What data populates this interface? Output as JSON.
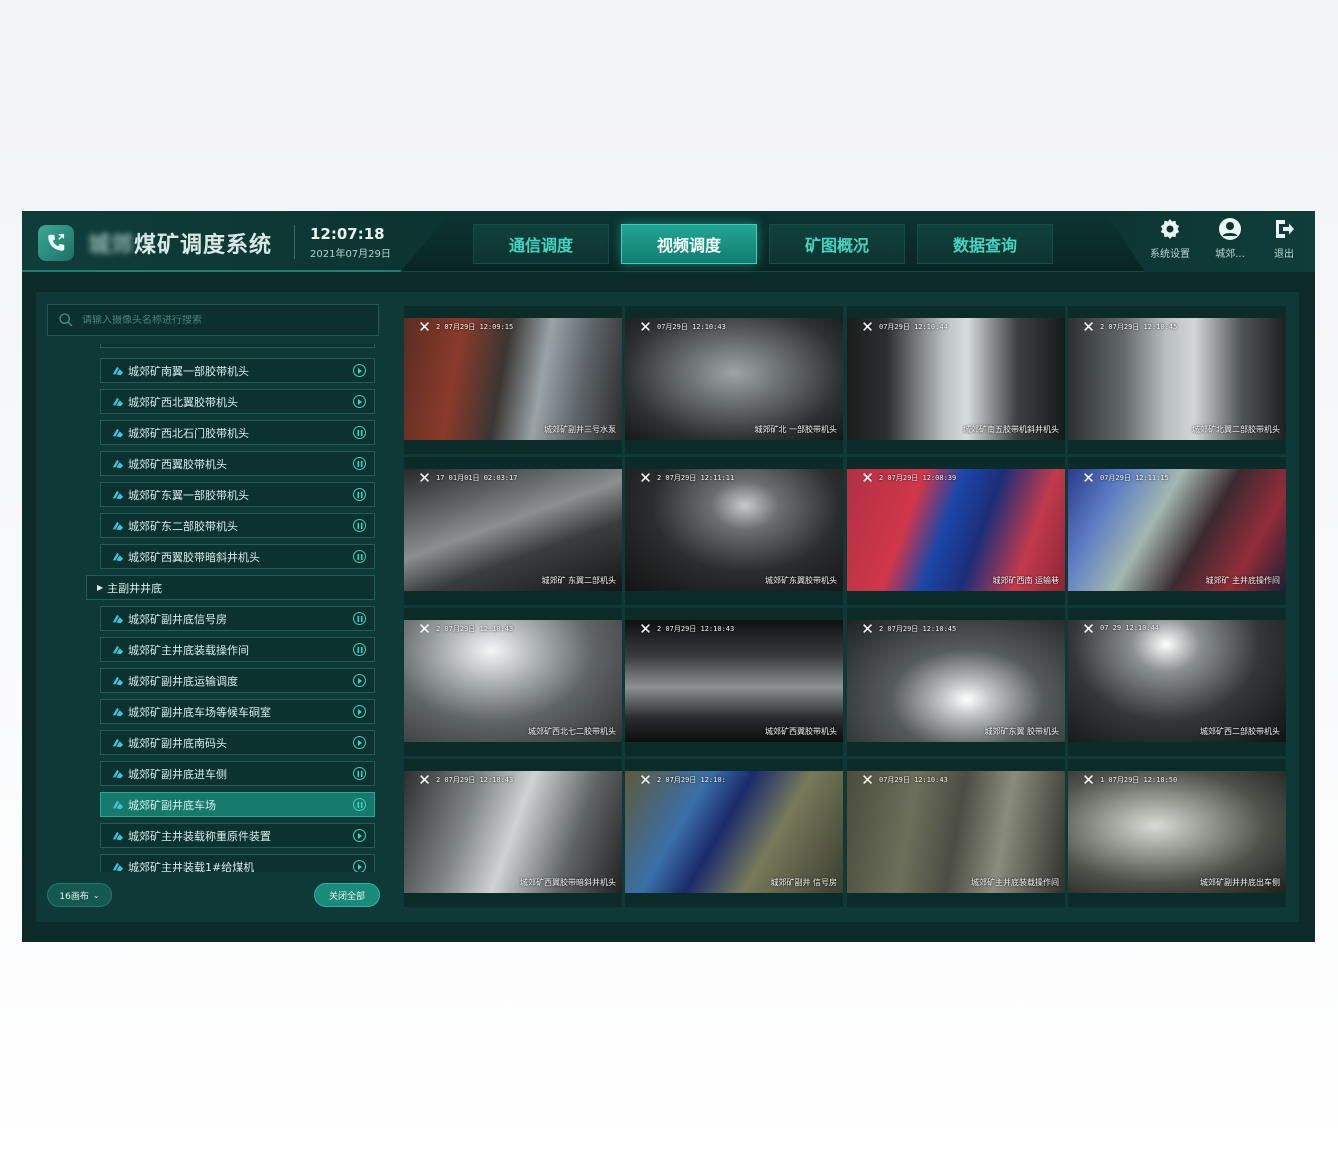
{
  "header": {
    "title_blurred": "城郊",
    "title": "煤矿调度系统",
    "time": "12:07:18",
    "date": "2021年07月29日",
    "tabs": [
      {
        "label": "通信调度",
        "active": false
      },
      {
        "label": "视频调度",
        "active": true
      },
      {
        "label": "矿图概况",
        "active": false
      },
      {
        "label": "数据查询",
        "active": false
      }
    ],
    "actions": {
      "settings": "系统设置",
      "user": "城郊...",
      "logout": "退出"
    }
  },
  "search": {
    "placeholder": "请输入摄像头名称进行搜索"
  },
  "tree": {
    "items_a": [
      {
        "label": "城郊矿南翼一部胶带机头",
        "icon": "camera-icon"
      },
      {
        "label": "城郊矿西北翼胶带机头",
        "icon": "camera-icon"
      },
      {
        "label": "城郊矿西北石门胶带机头",
        "icon": "camera-icon"
      },
      {
        "label": "城郊矿西翼胶带机头",
        "icon": "camera-icon"
      },
      {
        "label": "城郊矿东翼一部胶带机头",
        "icon": "camera-icon"
      },
      {
        "label": "城郊矿东二部胶带机头",
        "icon": "camera-icon"
      },
      {
        "label": "城郊矿西翼胶带暗斜井机头",
        "icon": "camera-icon"
      }
    ],
    "group": {
      "label": "主副井井底",
      "expanded": true
    },
    "items_b": [
      {
        "label": "城郊矿副井底信号房",
        "selected": false
      },
      {
        "label": "城郊矿主井底装载操作间",
        "selected": false
      },
      {
        "label": "城郊矿副井底运输调度",
        "selected": false
      },
      {
        "label": "城郊矿副井底车场等候车硐室",
        "selected": false
      },
      {
        "label": "城郊矿副井底南码头",
        "selected": false
      },
      {
        "label": "城郊矿副井底进车侧",
        "selected": false
      },
      {
        "label": "城郊矿副井底车场",
        "selected": true
      },
      {
        "label": "城郊矿主井装载称重原件装置",
        "selected": false
      },
      {
        "label": "城郊矿主井装载1#给煤机",
        "selected": false
      }
    ]
  },
  "footer": {
    "layout_label": "16画布",
    "close_all_label": "关闭全部"
  },
  "feeds": [
    {
      "ts": "2  07月29日  12:09:15",
      "cap": "城郊矿副井三号水泵"
    },
    {
      "ts": "07月29日  12:10:43",
      "cap": "城郊矿北  一部胶带机头"
    },
    {
      "ts": "07月29日  12:10:44",
      "cap": "城郊矿南五胶带机斜井机头"
    },
    {
      "ts": "2  07月29日  12:10:45",
      "cap": "城郊矿北翼二部胶带机头"
    },
    {
      "ts": "17  01月01日  02:03:17",
      "cap": "城郊矿  东翼二部机头"
    },
    {
      "ts": "2  07月29日  12:11:11",
      "cap": "城郊矿东翼胶带机头"
    },
    {
      "ts": "2  07月29日  12:08:39",
      "cap": "城郊矿西南  运输巷"
    },
    {
      "ts": "  07月29日  12:11:15",
      "cap": "城郊矿  主井底操作间"
    },
    {
      "ts": "2  07月29日  12:10:43",
      "cap": "城郊矿西北七二胶带机头"
    },
    {
      "ts": "2  07月29日  12:10:43",
      "cap": "城郊矿西翼胶带机头"
    },
    {
      "ts": "2  07月29日  12:10:45",
      "cap": "城郊矿东翼  胶带机头"
    },
    {
      "ts": "  07  29  12:10:44",
      "cap": "城郊矿西二部胶带机头"
    },
    {
      "ts": "2  07月29日  12:10:43",
      "cap": "城郊矿西翼胶带暗斜井机头"
    },
    {
      "ts": "2  07月29日  12:10:",
      "cap": "城郊矿副井  信号房"
    },
    {
      "ts": "07月29日  12:10:43",
      "cap": "城郊矿主井底装载操作间"
    },
    {
      "ts": "1  07月29日  12:10:50",
      "cap": "城郊矿副井井底出车侧"
    }
  ],
  "colors": {
    "accent": "#22a594",
    "panel": "#0e3936",
    "tab_text": "#47d3c0"
  }
}
